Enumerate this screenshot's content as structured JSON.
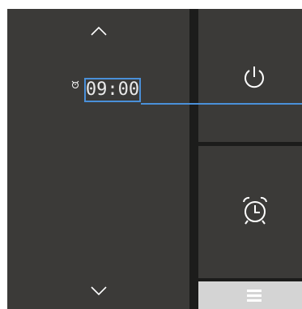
{
  "display": {
    "time": "09:00"
  },
  "colors": {
    "panel_bg": "#3b3a38",
    "separator": "#1c1c1b",
    "accent": "#4a90d9",
    "menu_bar": "#d4d4d4",
    "icon": "#ffffff"
  },
  "icons": {
    "up": "chevron-up-icon",
    "down": "chevron-down-icon",
    "alarm_indicator": "alarm-clock-icon",
    "power": "power-icon",
    "alarm": "alarm-clock-icon",
    "menu": "hamburger-menu-icon"
  }
}
